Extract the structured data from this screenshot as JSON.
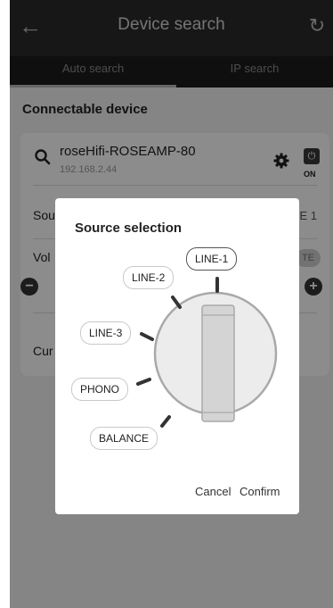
{
  "header": {
    "title": "Device search",
    "back_icon": "arrow-left-icon",
    "refresh_icon": "refresh-icon"
  },
  "tabs": [
    {
      "label": "Auto search",
      "selected": true
    },
    {
      "label": "IP search",
      "selected": false
    }
  ],
  "section": {
    "title": "Connectable device"
  },
  "device": {
    "name": "roseHifi-ROSEAMP-80",
    "ip": "192.168.2.44",
    "power_label": "ON",
    "rows": {
      "source_label": "Sou",
      "source_value": "E 1",
      "volume_label": "Vol",
      "current_label": "Cur",
      "mute_label": "TE"
    }
  },
  "dialog": {
    "title": "Source selection",
    "sources": [
      {
        "label": "LINE-1",
        "selected": true
      },
      {
        "label": "LINE-2",
        "selected": false
      },
      {
        "label": "LINE-3",
        "selected": false
      },
      {
        "label": "PHONO",
        "selected": false
      },
      {
        "label": "BALANCE",
        "selected": false
      }
    ],
    "cancel_label": "Cancel",
    "confirm_label": "Confirm"
  }
}
